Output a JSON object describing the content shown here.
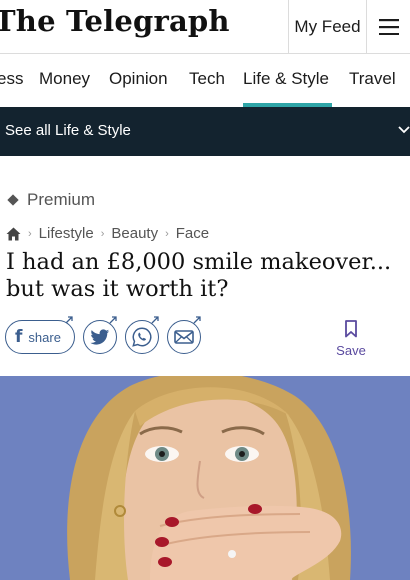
{
  "masthead": {
    "logo_text": "The Telegraph",
    "my_feed_label": "My Feed",
    "menu_icon": "hamburger-menu-icon"
  },
  "section_nav": {
    "items": [
      "ess",
      "Money",
      "Opinion",
      "Tech",
      "Life & Style",
      "Travel"
    ],
    "active": "Life & Style",
    "active_color": "#2fa5a7"
  },
  "sub_bar": {
    "label": "See all Life & Style",
    "background": "#13232f",
    "icon": "chevron-down-icon"
  },
  "article": {
    "premium_label": "Premium",
    "breadcrumb": [
      "Lifestyle",
      "Beauty",
      "Face"
    ],
    "headline": "I had an £8,000 smile makeover... but was it worth it?",
    "share_label": "share",
    "save_label": "Save"
  },
  "colors": {
    "share_blue": "#3b5e8e",
    "save_purple": "#5a4a9f",
    "hero_background": "#6e82c0"
  }
}
